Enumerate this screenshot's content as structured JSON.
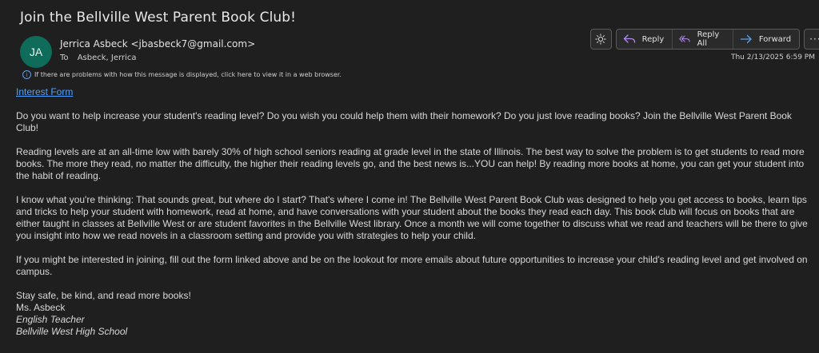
{
  "subject": "Join the Bellville West Parent Book Club!",
  "sender": {
    "initials": "JA",
    "avatar_color": "#0f6b5a",
    "name_email": "Jerrica Asbeck <jbasbeck7@gmail.com>",
    "to_label": "To",
    "to_value": "Asbeck, Jerrica"
  },
  "notice": "If there are problems with how this message is displayed, click here to view it in a web browser.",
  "toolbar": {
    "theme_icon": "sun-icon",
    "reply": "Reply",
    "reply_all": "Reply All",
    "forward": "Forward",
    "more": "···"
  },
  "date": "Thu 2/13/2025 6:59 PM",
  "body": {
    "link": "Interest Form",
    "p1": "Do you want to help increase your student's reading level? Do you wish you could help them with their homework? Do you just love reading books? Join the Bellville West Parent Book Club!",
    "p2": "Reading levels are at an all-time low with barely 30% of high school seniors reading at grade level in the state of Illinois. The best way to solve the problem is to get students to read more books. The more they read, no matter the difficulty, the higher their reading levels go, and the best news is...YOU can help! By reading more books at home, you can get your student into the habit of reading.",
    "p3": "I know what you're thinking: That sounds great, but where do I start? That's where I come in! The Bellville West Parent Book Club was designed to help you get access to books, learn tips and tricks to help your student with homework, read at home, and have conversations with your student about the books they read each day. This book club will focus on books that are either taught in classes at Bellville West or are student favorites in the Bellville West library. Once a month we will come together to discuss what we read and teachers will be there to give you insight into how we read novels in a classroom setting and provide you with strategies to help your child.",
    "p4": "If you might be interested in joining, fill out the form linked above and be on the lookout for more emails about future opportunities to increase your child's reading level and get involved on campus.",
    "closing": "Stay safe, be kind, and read more books!",
    "sig_name": "Ms. Asbeck",
    "sig_title": "English Teacher",
    "sig_school": "Bellville West High School"
  },
  "colors": {
    "background": "#1f1f1f",
    "link": "#4ea1ff",
    "accent": "#5aa0e8"
  }
}
